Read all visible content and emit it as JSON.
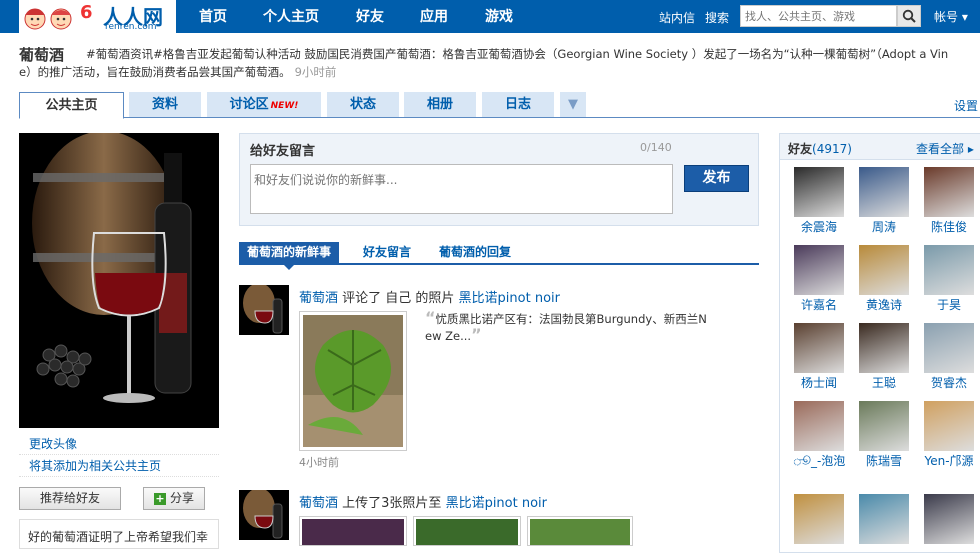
{
  "topbar": {
    "logo": {
      "six": "6",
      "brand": "人人网",
      "sub": "renren.com"
    },
    "nav": [
      "首页",
      "个人主页",
      "好友",
      "应用",
      "游戏"
    ],
    "right_links": [
      "站内信",
      "搜索"
    ],
    "search_placeholder": "找人、公共主页、游戏",
    "account": "帐号"
  },
  "profile": {
    "name": "葡萄酒",
    "status_line1": "#葡萄酒资讯#格鲁吉亚发起葡萄认种活动   鼓励国民消费国产葡萄酒：格鲁吉亚葡萄酒协会（Georgian Wine Society ）发起了一场名为“认种一棵葡萄树”（Adopt a Vin",
    "status_line2": "e）的推广活动，旨在鼓励消费者品尝其国产葡萄酒。",
    "status_time": "9小时前"
  },
  "tabs": {
    "items": [
      "公共主页",
      "资料",
      "讨论区",
      "状态",
      "相册",
      "日志"
    ],
    "new_badge": "NEW!",
    "settings": "设置"
  },
  "left": {
    "change_avatar": "更改头像",
    "add_related": "将其添加为相关公共主页",
    "recommend": "推荐给好友",
    "share": "分享",
    "bio": "好的葡萄酒证明了上帝希望我们幸"
  },
  "message": {
    "title": "给好友留言",
    "count": "0/140",
    "placeholder": "和好友们说说你的新鲜事...",
    "publish": "发布"
  },
  "feed_tabs": [
    "葡萄酒的新鲜事",
    "好友留言",
    "葡萄酒的回复"
  ],
  "feed": [
    {
      "actor": "葡萄酒",
      "action": " 评论了 自己 的照片 ",
      "target": "黑比诺pinot noir",
      "quote_line1": "忧质黑比诺产区有：法国勃艮第Burgundy、新西兰N",
      "quote_line2": "ew Ze...",
      "time": "4小时前"
    },
    {
      "actor": "葡萄酒",
      "action": " 上传了3张照片至 ",
      "target": "黑比诺pinot noir"
    }
  ],
  "friends": {
    "title": "好友",
    "count": "(4917)",
    "view_all": "查看全部",
    "list": [
      "余震海",
      "周涛",
      "陈佳俊",
      "许嘉名",
      "黄逸诗",
      "于昊",
      "杨士闻",
      "王聪",
      "贺睿杰",
      "ூ_-泡泡",
      "陈瑞雪",
      "Yen-邝源",
      "",
      "",
      ""
    ]
  },
  "colors": {
    "brand_blue": "#005eac",
    "tab_bg": "#d8e6f5",
    "publish_btn": "#1c5da8"
  }
}
